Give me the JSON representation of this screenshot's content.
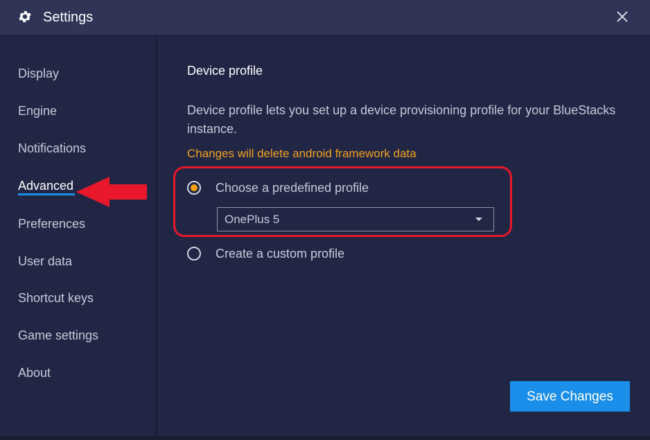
{
  "window": {
    "title": "Settings",
    "title_icon": "gear-icon",
    "close_icon": "close-icon"
  },
  "sidebar": {
    "items": [
      {
        "label": "Display",
        "active": false
      },
      {
        "label": "Engine",
        "active": false
      },
      {
        "label": "Notifications",
        "active": false
      },
      {
        "label": "Advanced",
        "active": true
      },
      {
        "label": "Preferences",
        "active": false
      },
      {
        "label": "User data",
        "active": false
      },
      {
        "label": "Shortcut keys",
        "active": false
      },
      {
        "label": "Game settings",
        "active": false
      },
      {
        "label": "About",
        "active": false
      }
    ]
  },
  "main": {
    "section_title": "Device profile",
    "description": "Device profile lets you set up a device provisioning profile for your BlueStacks instance.",
    "warning": "Changes will delete android framework data",
    "options": [
      {
        "label": "Choose a predefined profile",
        "selected": true
      },
      {
        "label": "Create a custom profile",
        "selected": false
      }
    ],
    "profile_select": {
      "value": "OnePlus 5"
    },
    "save_label": "Save Changes"
  },
  "annotation": {
    "arrow_icon": "red-arrow-icon",
    "highlight_color": "#e8172a"
  },
  "colors": {
    "background": "#222645",
    "titlebar": "#303456",
    "accent_blue": "#1a8ee8",
    "accent_orange": "#f5a00f",
    "warning_text": "#f0a21e"
  }
}
